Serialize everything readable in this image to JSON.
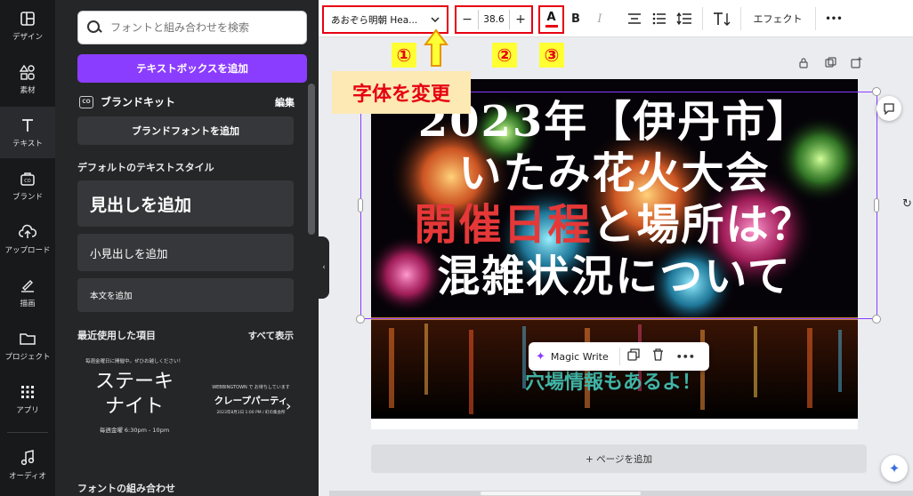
{
  "rail": {
    "items": [
      {
        "label": "デザイン",
        "icon": "layout-icon"
      },
      {
        "label": "素材",
        "icon": "elements-icon"
      },
      {
        "label": "テキスト",
        "icon": "text-icon"
      },
      {
        "label": "ブランド",
        "icon": "brand-icon"
      },
      {
        "label": "アップロード",
        "icon": "upload-icon"
      },
      {
        "label": "描画",
        "icon": "draw-icon"
      },
      {
        "label": "プロジェクト",
        "icon": "folder-icon"
      },
      {
        "label": "アプリ",
        "icon": "apps-icon"
      },
      {
        "label": "オーディオ",
        "icon": "music-icon"
      }
    ]
  },
  "panel": {
    "search_placeholder": "フォントと組み合わせを検索",
    "add_textbox": "テキストボックスを追加",
    "brandkit": "ブランドキット",
    "edit": "編集",
    "add_brand_font": "ブランドフォントを追加",
    "default_styles_title": "デフォルトのテキストスタイル",
    "add_heading": "見出しを追加",
    "add_subheading": "小見出しを追加",
    "add_body": "本文を追加",
    "recent_title": "最近使用した項目",
    "show_all": "すべて表示",
    "recent1": {
      "tiny": "毎週金曜日に開催中。ぜひお越しください！",
      "big1": "ステーキ",
      "big2": "ナイト",
      "date": "毎週金曜 6:30pm - 10pm"
    },
    "recent2": {
      "tiny": "WEBBINGTOWN で お待ちしています",
      "big": "クレープパーティ",
      "date": "2023年8月1日 1:00 PM / 町の集会所"
    },
    "combos_title": "フォントの組み合わせ"
  },
  "toolbar": {
    "font": "あおぞら明朝 Hea...",
    "font_size": "38.6",
    "minus": "−",
    "plus": "+",
    "color_letter": "A",
    "bold": "B",
    "italic": "I",
    "effects": "エフェクト",
    "more": "•••"
  },
  "annotations": {
    "n1": "①",
    "n2": "②",
    "n3": "③",
    "label": "字体を変更"
  },
  "canvas": {
    "line1": "2023年【伊丹市】",
    "line2": "いたみ花火大会",
    "line3_red": "開催日程",
    "line3_white": "と場所は？",
    "line4": "混雑状況について",
    "subtitle": "穴場情報もあるよ！",
    "magic_write": "Magic Write",
    "add_page": "+ ページを追加"
  },
  "colors": {
    "accent": "#8b3dff",
    "annotation_red": "#e60012",
    "highlight_yellow": "#ffff33",
    "headline_red": "#e53838",
    "subtitle_teal": "#3fb6a8"
  }
}
